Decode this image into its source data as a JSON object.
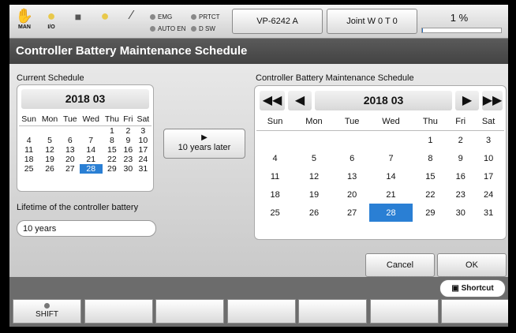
{
  "topbar": {
    "mode_label": "MAN",
    "io_label": "I/O",
    "status_leds": [
      "EMG",
      "PRTCT",
      "AUTO EN",
      "D SW"
    ],
    "robot_model": "VP-6242 A",
    "joint_label": "Joint  W 0 T 0",
    "speed_text": "1 %",
    "speed_percent": 1
  },
  "title": "Controller Battery Maintenance Schedule",
  "current": {
    "label": "Current Schedule",
    "month": "2018 03",
    "weekdays": [
      "Sun",
      "Mon",
      "Tue",
      "Wed",
      "Thu",
      "Fri",
      "Sat"
    ],
    "weeks": [
      [
        "",
        "",
        "",
        "",
        "1",
        "2",
        "3"
      ],
      [
        "4",
        "5",
        "6",
        "7",
        "8",
        "9",
        "10"
      ],
      [
        "11",
        "12",
        "13",
        "14",
        "15",
        "16",
        "17"
      ],
      [
        "18",
        "19",
        "20",
        "21",
        "22",
        "23",
        "24"
      ],
      [
        "25",
        "26",
        "27",
        "28",
        "29",
        "30",
        "31"
      ]
    ],
    "selected_day": "28"
  },
  "later_button": "10 years later",
  "lifetime": {
    "label": "Lifetime of the controller battery",
    "value": "10 years"
  },
  "schedule": {
    "label": "Controller Battery Maintenance Schedule",
    "month": "2018 03",
    "weekdays": [
      "Sun",
      "Mon",
      "Tue",
      "Wed",
      "Thu",
      "Fri",
      "Sat"
    ],
    "weeks": [
      [
        "",
        "",
        "",
        "",
        "1",
        "2",
        "3"
      ],
      [
        "4",
        "5",
        "6",
        "7",
        "8",
        "9",
        "10"
      ],
      [
        "11",
        "12",
        "13",
        "14",
        "15",
        "16",
        "17"
      ],
      [
        "18",
        "19",
        "20",
        "21",
        "22",
        "23",
        "24"
      ],
      [
        "25",
        "26",
        "27",
        "28",
        "29",
        "30",
        "31"
      ]
    ],
    "selected_day": "28"
  },
  "buttons": {
    "cancel": "Cancel",
    "ok": "OK"
  },
  "shortcut": "Shortcut",
  "fkeys": [
    "SHIFT",
    "",
    "",
    "",
    "",
    "",
    ""
  ],
  "colors": {
    "title_bar": "#4a4a4a",
    "selected_day": "#2a7fd4",
    "background": "#707070"
  }
}
